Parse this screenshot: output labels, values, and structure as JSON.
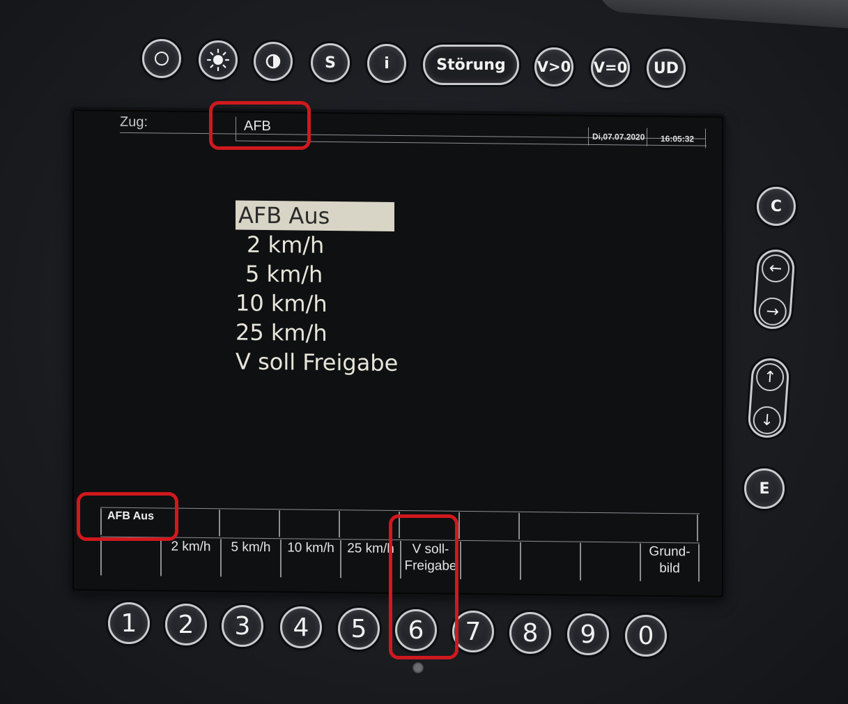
{
  "top_buttons": {
    "s_label": "S",
    "i_label": "i",
    "stoerung_label": "Störung",
    "v_gt_0_label": "V>0",
    "v_eq_0_label": "V=0",
    "ud_label": "UD"
  },
  "right_buttons": {
    "c_label": "C",
    "e_label": "E",
    "left_arrow": "←",
    "right_arrow": "→",
    "up_arrow": "↑",
    "down_arrow": "↓"
  },
  "screen": {
    "header": {
      "zug_label": "Zug:",
      "zug_value": "AFB",
      "date": "Di,07.07.2020",
      "time": "16:05:32"
    },
    "menu": {
      "items": [
        "AFB Aus",
        "2 km/h",
        "5 km/h",
        "10 km/h",
        "25 km/h",
        "V soll Freigabe"
      ],
      "selected_index": 0
    },
    "status": {
      "afb_state": "AFB Aus"
    },
    "softkeys": [
      "",
      "2 km/h",
      "5 km/h",
      "10 km/h",
      "25 km/h",
      "V soll-\nFreigabe",
      "",
      "",
      "",
      "Grund-\nbild"
    ]
  },
  "number_buttons": [
    "1",
    "2",
    "3",
    "4",
    "5",
    "6",
    "7",
    "8",
    "9",
    "0"
  ],
  "colors": {
    "highlight_red": "#d0191e",
    "selection_bg": "#d8d5c7",
    "screen_bg": "#0f1012"
  }
}
